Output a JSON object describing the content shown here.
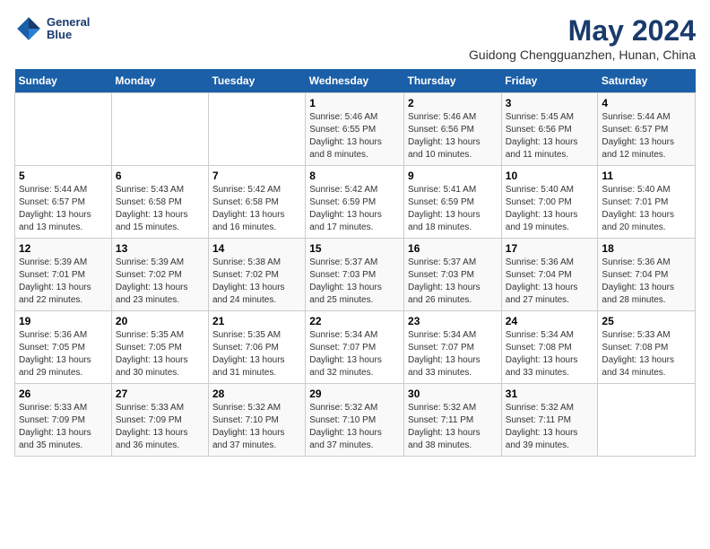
{
  "header": {
    "logo_line1": "General",
    "logo_line2": "Blue",
    "title": "May 2024",
    "subtitle": "Guidong Chengguanzhen, Hunan, China"
  },
  "days_of_week": [
    "Sunday",
    "Monday",
    "Tuesday",
    "Wednesday",
    "Thursday",
    "Friday",
    "Saturday"
  ],
  "weeks": [
    [
      {
        "num": "",
        "info": ""
      },
      {
        "num": "",
        "info": ""
      },
      {
        "num": "",
        "info": ""
      },
      {
        "num": "1",
        "info": "Sunrise: 5:46 AM\nSunset: 6:55 PM\nDaylight: 13 hours\nand 8 minutes."
      },
      {
        "num": "2",
        "info": "Sunrise: 5:46 AM\nSunset: 6:56 PM\nDaylight: 13 hours\nand 10 minutes."
      },
      {
        "num": "3",
        "info": "Sunrise: 5:45 AM\nSunset: 6:56 PM\nDaylight: 13 hours\nand 11 minutes."
      },
      {
        "num": "4",
        "info": "Sunrise: 5:44 AM\nSunset: 6:57 PM\nDaylight: 13 hours\nand 12 minutes."
      }
    ],
    [
      {
        "num": "5",
        "info": "Sunrise: 5:44 AM\nSunset: 6:57 PM\nDaylight: 13 hours\nand 13 minutes."
      },
      {
        "num": "6",
        "info": "Sunrise: 5:43 AM\nSunset: 6:58 PM\nDaylight: 13 hours\nand 15 minutes."
      },
      {
        "num": "7",
        "info": "Sunrise: 5:42 AM\nSunset: 6:58 PM\nDaylight: 13 hours\nand 16 minutes."
      },
      {
        "num": "8",
        "info": "Sunrise: 5:42 AM\nSunset: 6:59 PM\nDaylight: 13 hours\nand 17 minutes."
      },
      {
        "num": "9",
        "info": "Sunrise: 5:41 AM\nSunset: 6:59 PM\nDaylight: 13 hours\nand 18 minutes."
      },
      {
        "num": "10",
        "info": "Sunrise: 5:40 AM\nSunset: 7:00 PM\nDaylight: 13 hours\nand 19 minutes."
      },
      {
        "num": "11",
        "info": "Sunrise: 5:40 AM\nSunset: 7:01 PM\nDaylight: 13 hours\nand 20 minutes."
      }
    ],
    [
      {
        "num": "12",
        "info": "Sunrise: 5:39 AM\nSunset: 7:01 PM\nDaylight: 13 hours\nand 22 minutes."
      },
      {
        "num": "13",
        "info": "Sunrise: 5:39 AM\nSunset: 7:02 PM\nDaylight: 13 hours\nand 23 minutes."
      },
      {
        "num": "14",
        "info": "Sunrise: 5:38 AM\nSunset: 7:02 PM\nDaylight: 13 hours\nand 24 minutes."
      },
      {
        "num": "15",
        "info": "Sunrise: 5:37 AM\nSunset: 7:03 PM\nDaylight: 13 hours\nand 25 minutes."
      },
      {
        "num": "16",
        "info": "Sunrise: 5:37 AM\nSunset: 7:03 PM\nDaylight: 13 hours\nand 26 minutes."
      },
      {
        "num": "17",
        "info": "Sunrise: 5:36 AM\nSunset: 7:04 PM\nDaylight: 13 hours\nand 27 minutes."
      },
      {
        "num": "18",
        "info": "Sunrise: 5:36 AM\nSunset: 7:04 PM\nDaylight: 13 hours\nand 28 minutes."
      }
    ],
    [
      {
        "num": "19",
        "info": "Sunrise: 5:36 AM\nSunset: 7:05 PM\nDaylight: 13 hours\nand 29 minutes."
      },
      {
        "num": "20",
        "info": "Sunrise: 5:35 AM\nSunset: 7:05 PM\nDaylight: 13 hours\nand 30 minutes."
      },
      {
        "num": "21",
        "info": "Sunrise: 5:35 AM\nSunset: 7:06 PM\nDaylight: 13 hours\nand 31 minutes."
      },
      {
        "num": "22",
        "info": "Sunrise: 5:34 AM\nSunset: 7:07 PM\nDaylight: 13 hours\nand 32 minutes."
      },
      {
        "num": "23",
        "info": "Sunrise: 5:34 AM\nSunset: 7:07 PM\nDaylight: 13 hours\nand 33 minutes."
      },
      {
        "num": "24",
        "info": "Sunrise: 5:34 AM\nSunset: 7:08 PM\nDaylight: 13 hours\nand 33 minutes."
      },
      {
        "num": "25",
        "info": "Sunrise: 5:33 AM\nSunset: 7:08 PM\nDaylight: 13 hours\nand 34 minutes."
      }
    ],
    [
      {
        "num": "26",
        "info": "Sunrise: 5:33 AM\nSunset: 7:09 PM\nDaylight: 13 hours\nand 35 minutes."
      },
      {
        "num": "27",
        "info": "Sunrise: 5:33 AM\nSunset: 7:09 PM\nDaylight: 13 hours\nand 36 minutes."
      },
      {
        "num": "28",
        "info": "Sunrise: 5:32 AM\nSunset: 7:10 PM\nDaylight: 13 hours\nand 37 minutes."
      },
      {
        "num": "29",
        "info": "Sunrise: 5:32 AM\nSunset: 7:10 PM\nDaylight: 13 hours\nand 37 minutes."
      },
      {
        "num": "30",
        "info": "Sunrise: 5:32 AM\nSunset: 7:11 PM\nDaylight: 13 hours\nand 38 minutes."
      },
      {
        "num": "31",
        "info": "Sunrise: 5:32 AM\nSunset: 7:11 PM\nDaylight: 13 hours\nand 39 minutes."
      },
      {
        "num": "",
        "info": ""
      }
    ]
  ]
}
